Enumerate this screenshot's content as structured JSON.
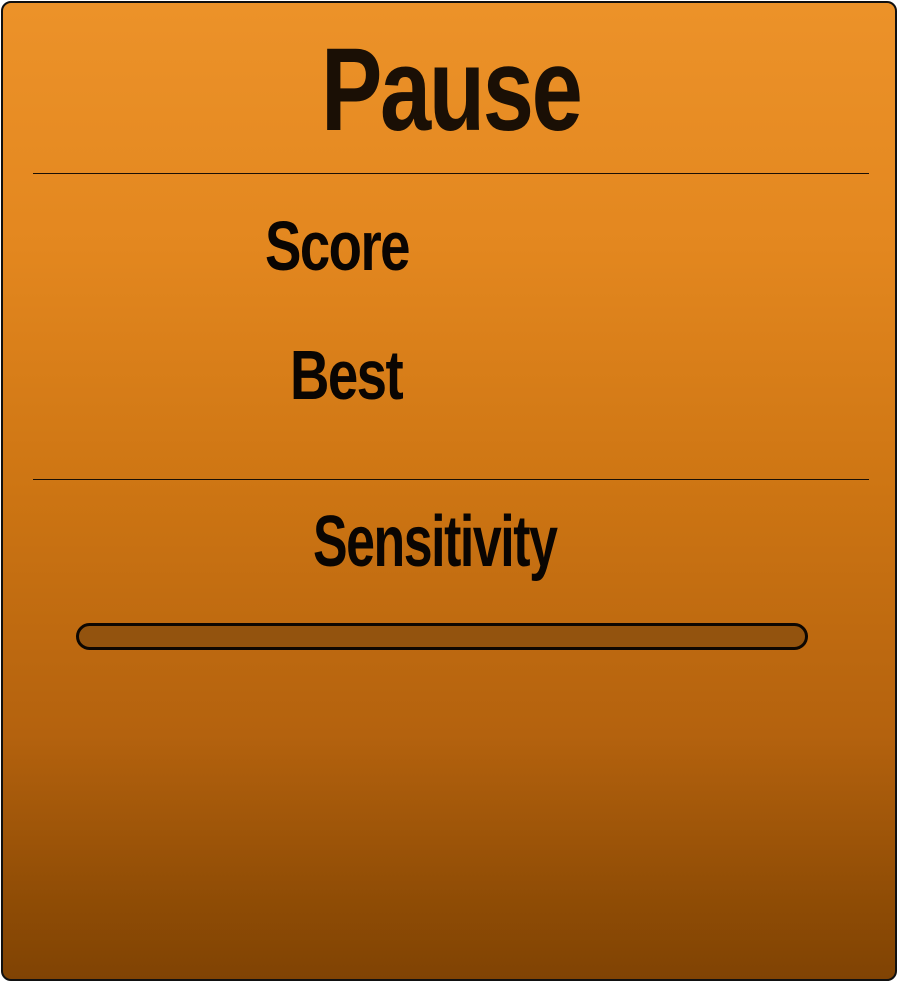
{
  "pause_menu": {
    "title": "Pause",
    "score_label": "Score",
    "best_label": "Best",
    "sensitivity_label": "Sensitivity"
  },
  "sensitivity_slider": {
    "value_fraction": 0.0
  },
  "colors": {
    "panel_top": "#ec9229",
    "panel_bottom": "#804304",
    "text": "#0a0502",
    "slider_track": "#93530e",
    "border": "#111111"
  }
}
